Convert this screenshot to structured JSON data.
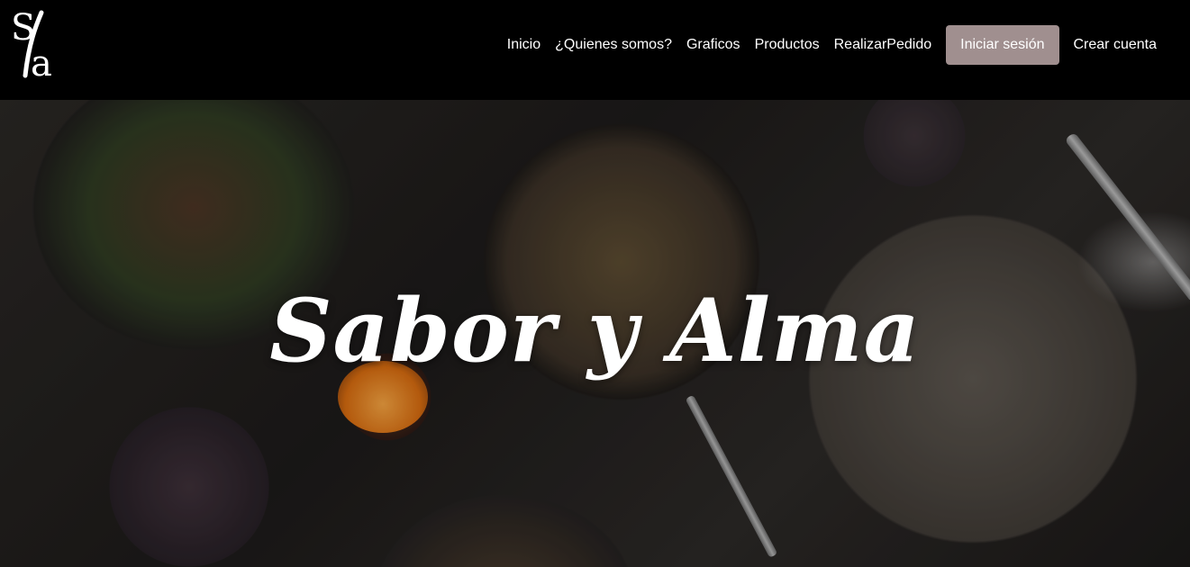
{
  "brand": {
    "logo_text": "Sa",
    "logo_color": "#ffffff"
  },
  "nav": {
    "links": [
      "Inicio",
      "¿Quienes somos?",
      "Graficos",
      "Productos",
      "RealizarPedido"
    ],
    "login_label": "Iniciar sesión",
    "signup_label": "Crear cuenta",
    "login_bg": "#a08f8f"
  },
  "hero": {
    "title": "Sabor y Alma",
    "image_desc_icon": "food-table-photo"
  }
}
